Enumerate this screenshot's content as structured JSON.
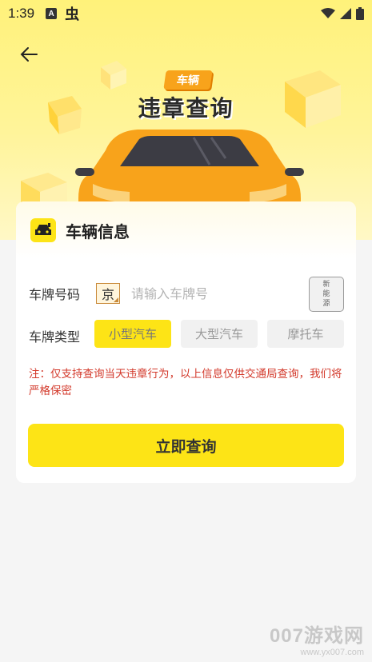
{
  "status_bar": {
    "time": "1:39",
    "notification_a": "A",
    "notification_glyph": "虫"
  },
  "header": {
    "back_icon": "arrow-left-icon",
    "tag_label": "车辆",
    "title": "违章查询"
  },
  "card": {
    "title": "车辆信息",
    "plate_label": "车牌号码",
    "province": "京",
    "plate_placeholder": "请输入车牌号",
    "new_energy_chars": [
      "新",
      "能",
      "源"
    ],
    "type_label": "车牌类型",
    "types": [
      {
        "label": "小型汽车",
        "active": true
      },
      {
        "label": "大型汽车",
        "active": false
      },
      {
        "label": "摩托车",
        "active": false
      }
    ],
    "note": "注：仅支持查询当天违章行为，以上信息仅供交通局查询，我们将严格保密",
    "query_button": "立即查询"
  },
  "watermark": {
    "brand": "007游戏网",
    "url": "www.yx007.com"
  },
  "colors": {
    "accent_yellow": "#fde416",
    "car_orange": "#f8a31b",
    "note_red": "#d33a2c"
  }
}
